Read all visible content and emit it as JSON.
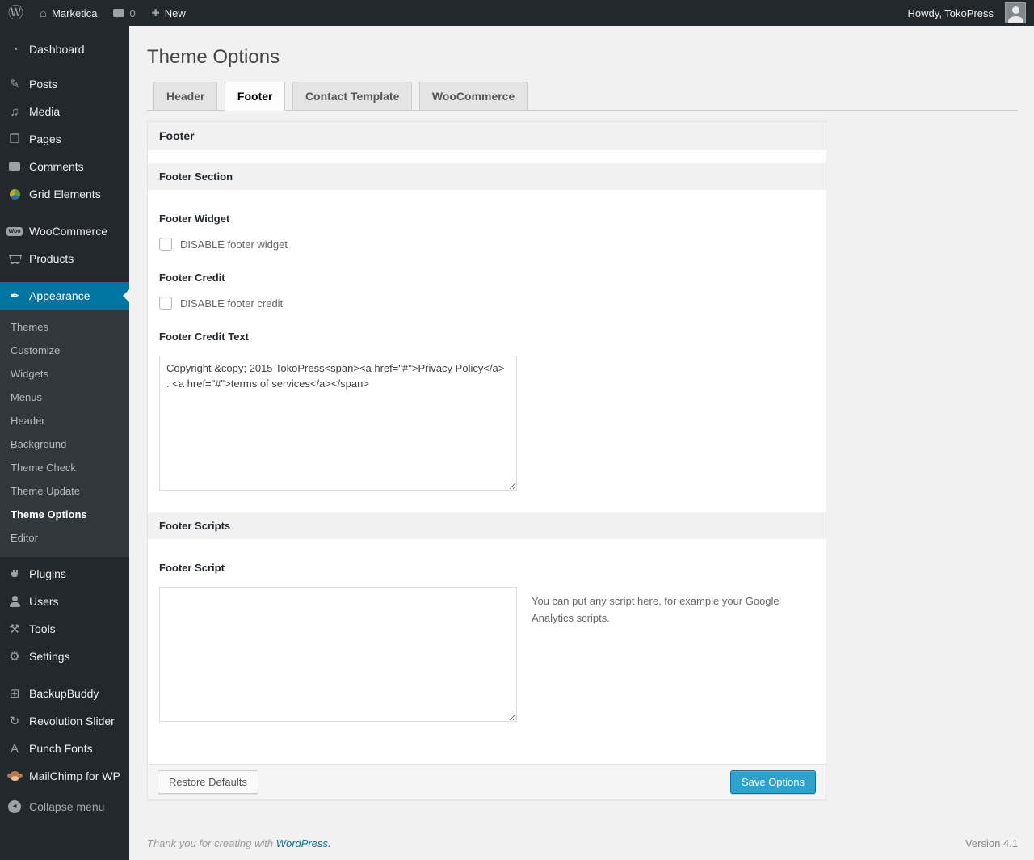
{
  "admin_bar": {
    "site_name": "Marketica",
    "comments_count": "0",
    "new_label": "New",
    "howdy_label": "Howdy, TokoPress"
  },
  "icons": {
    "wordpress_logo": "Ⓦ",
    "home": "⌂",
    "plus": "✚",
    "dashboard": "◔",
    "posts": "✎",
    "media": "♫",
    "pages": "❐",
    "appearance": "✒",
    "tools": "⚒",
    "settings": "⚙",
    "backupbuddy": "⊞",
    "revolution_slider": "↻",
    "punch_fonts": "A",
    "collapse_arrow": "◂",
    "woo_badge": "Woo"
  },
  "sidebar": {
    "items": [
      {
        "label": "Dashboard"
      },
      {
        "label": "Posts"
      },
      {
        "label": "Media"
      },
      {
        "label": "Pages"
      },
      {
        "label": "Comments"
      },
      {
        "label": "Grid Elements"
      },
      {
        "label": "WooCommerce"
      },
      {
        "label": "Products"
      },
      {
        "label": "Appearance"
      },
      {
        "label": "Plugins"
      },
      {
        "label": "Users"
      },
      {
        "label": "Tools"
      },
      {
        "label": "Settings"
      },
      {
        "label": "BackupBuddy"
      },
      {
        "label": "Revolution Slider"
      },
      {
        "label": "Punch Fonts"
      },
      {
        "label": "MailChimp for WP"
      },
      {
        "label": "Collapse menu"
      }
    ],
    "appearance_submenu": [
      "Themes",
      "Customize",
      "Widgets",
      "Menus",
      "Header",
      "Background",
      "Theme Check",
      "Theme Update",
      "Theme Options",
      "Editor"
    ]
  },
  "page": {
    "title": "Theme Options",
    "tabs": [
      {
        "label": "Header",
        "active": false
      },
      {
        "label": "Footer",
        "active": true
      },
      {
        "label": "Contact Template",
        "active": false
      },
      {
        "label": "WooCommerce",
        "active": false
      }
    ]
  },
  "panel": {
    "header": "Footer",
    "section_footer": {
      "title": "Footer Section",
      "fields": {
        "footer_widget": {
          "label": "Footer Widget",
          "checkbox_label": "DISABLE footer widget",
          "checked": false
        },
        "footer_credit": {
          "label": "Footer Credit",
          "checkbox_label": "DISABLE footer credit",
          "checked": false
        },
        "footer_credit_text": {
          "label": "Footer Credit Text",
          "value": "Copyright &copy; 2015 TokoPress<span><a href=\"#\">Privacy Policy</a> . <a href=\"#\">terms of services</a></span>"
        }
      }
    },
    "section_scripts": {
      "title": "Footer Scripts",
      "fields": {
        "footer_script": {
          "label": "Footer Script",
          "value": "",
          "helper": "You can put any script here, for example your Google Analytics scripts."
        }
      }
    },
    "buttons": {
      "restore": "Restore Defaults",
      "save": "Save Options"
    }
  },
  "page_footer": {
    "thanks_text": "Thank you for creating with ",
    "wordpress_link": "WordPress.",
    "version": "Version 4.1"
  },
  "colors": {
    "accent": "#0074a2",
    "primary_button": "#2ea2cc",
    "page_bg": "#f1f1f1",
    "menu_bg": "#23282d",
    "submenu_bg": "#32373c"
  }
}
